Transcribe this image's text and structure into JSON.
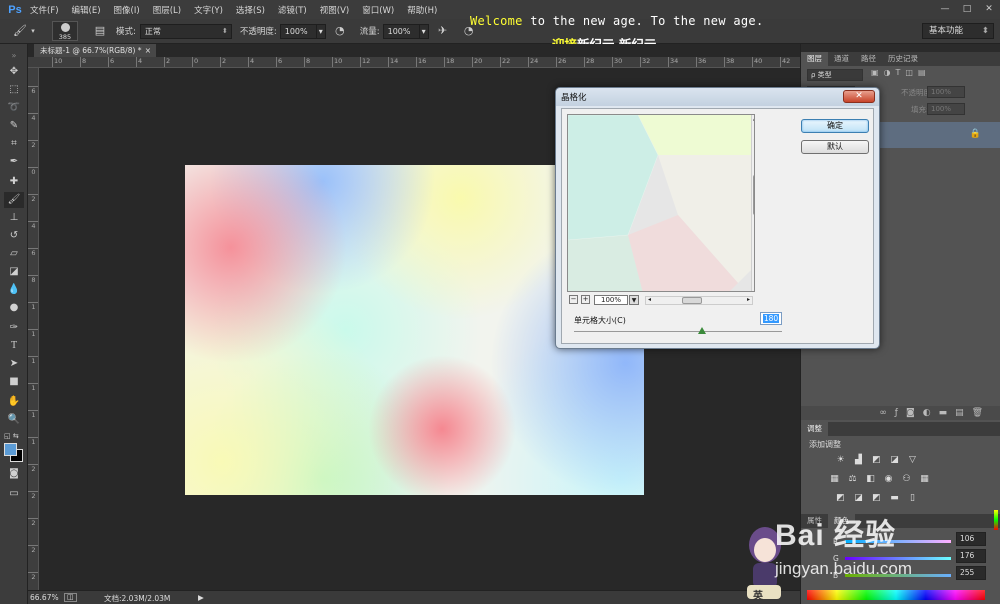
{
  "app": {
    "logo": "Ps",
    "menu": [
      "文件(F)",
      "编辑(E)",
      "图像(I)",
      "图层(L)",
      "文字(Y)",
      "选择(S)",
      "滤镜(T)",
      "视图(V)",
      "窗口(W)",
      "帮助(H)"
    ],
    "window_controls": [
      "—",
      "□",
      "✕"
    ]
  },
  "overlay": {
    "line1_highlight": "Welcome",
    "line1_rest": " to the new age. To the new age.",
    "line2_highlight": "迎接",
    "line2_rest": "新纪元 新纪元"
  },
  "options_bar": {
    "brush_size": "385",
    "mode_label": "模式:",
    "mode_value": "正常",
    "opacity_label": "不透明度:",
    "opacity_value": "100%",
    "flow_label": "流量:",
    "flow_value": "100%",
    "workspace": "基本功能"
  },
  "document": {
    "tab_title": "未标题-1 @ 66.7%(RGB/8) *",
    "tab_close": "×",
    "ruler_h": [
      "10",
      "8",
      "6",
      "4",
      "2",
      "0",
      "2",
      "4",
      "6",
      "8",
      "10",
      "12",
      "14",
      "16",
      "18",
      "20",
      "22",
      "24",
      "26",
      "28",
      "30",
      "32",
      "34",
      "36",
      "38",
      "40",
      "42",
      "44"
    ],
    "ruler_v": [
      "6",
      "4",
      "2",
      "0",
      "2",
      "4",
      "6",
      "8",
      "1",
      "1",
      "1",
      "1",
      "1",
      "1",
      "2",
      "2",
      "2",
      "2",
      "2"
    ],
    "zoom": "66.67%",
    "doc_info": "文档:2.03M/2.03M"
  },
  "dialog": {
    "title": "晶格化",
    "close": "✕",
    "ok": "确定",
    "default": "默认",
    "zoom_value": "100%",
    "zoom_minus": "−",
    "zoom_plus": "+",
    "cell_size_label": "单元格大小(C)",
    "cell_size_value": "180"
  },
  "panels": {
    "layers_tabs": [
      "图层",
      "通道",
      "路径",
      "历史记录"
    ],
    "filter_label": "ρ 类型",
    "opacity_label": "不透明度:",
    "opacity_value": "100%",
    "fill_label": "填充:",
    "fill_value": "100%",
    "adjust_tab": "调整",
    "adjust_title": "添加调整",
    "props_tabs": [
      "属性",
      "颜色"
    ],
    "color": {
      "R": "106",
      "G": "176",
      "B": "255"
    },
    "color_labels": [
      "R",
      "G",
      "B"
    ]
  },
  "watermark": {
    "text1": "Bai 经验",
    "text2": "jingyan.baidu.com",
    "badge": "英"
  },
  "colors": {
    "foreground": "#5b9bd5",
    "background": "#000000",
    "accent": "#4ea2ff"
  }
}
